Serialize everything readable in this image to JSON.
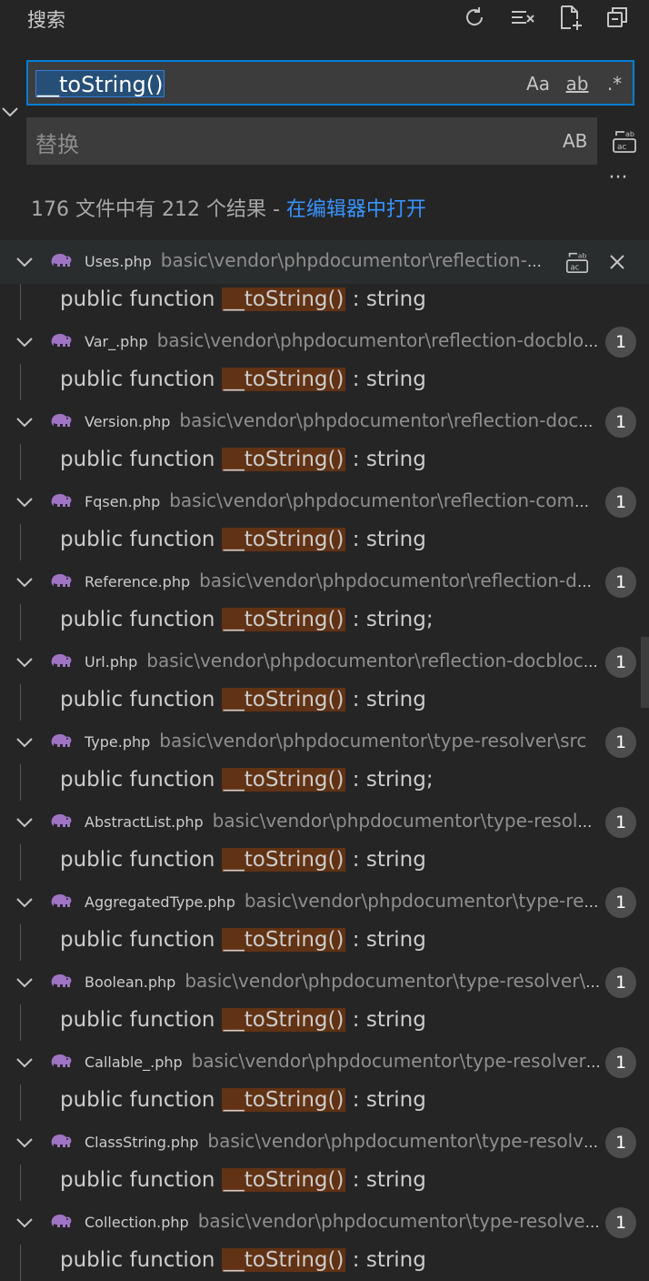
{
  "panel": {
    "title": "搜索",
    "actions": [
      {
        "name": "refresh-icon"
      },
      {
        "name": "clear-results-icon"
      },
      {
        "name": "new-search-editor-icon"
      },
      {
        "name": "collapse-all-icon"
      }
    ]
  },
  "search": {
    "value": "__toString()",
    "options": {
      "match_case": "Aa",
      "whole_word": "ab",
      "regex": ".*"
    }
  },
  "replace": {
    "placeholder": "替换",
    "preserve_case": "AB"
  },
  "summary": {
    "text": "176 文件中有 212 个结果 - ",
    "link": "在编辑器中打开"
  },
  "results": [
    {
      "file": "Uses.php",
      "path": "basic\\vendor\\phpdocumentor\\reflection-docblock\\src\\DocBlock\\Tags\\Uses.php",
      "count": "",
      "match_prefix": "public function ",
      "match": "__toString()",
      "match_suffix": " : string",
      "selected": true
    },
    {
      "file": "Var_.php",
      "path": "basic\\vendor\\phpdocumentor\\reflection-docblock\\src\\DocBlock\\Tags",
      "count": "1",
      "match_prefix": "public function ",
      "match": "__toString()",
      "match_suffix": " : string"
    },
    {
      "file": "Version.php",
      "path": "basic\\vendor\\phpdocumentor\\reflection-docblock\\src\\DocBlock",
      "count": "1",
      "match_prefix": "public function ",
      "match": "__toString()",
      "match_suffix": " : string"
    },
    {
      "file": "Fqsen.php",
      "path": "basic\\vendor\\phpdocumentor\\reflection-common\\src",
      "count": "1",
      "match_prefix": "public function ",
      "match": "__toString()",
      "match_suffix": " : string"
    },
    {
      "file": "Reference.php",
      "path": "basic\\vendor\\phpdocumentor\\reflection-docblock\\src",
      "count": "1",
      "match_prefix": "public function ",
      "match": "__toString()",
      "match_suffix": " : string;"
    },
    {
      "file": "Url.php",
      "path": "basic\\vendor\\phpdocumentor\\reflection-docblock\\src\\DocBlock",
      "count": "1",
      "match_prefix": "public function ",
      "match": "__toString()",
      "match_suffix": " : string"
    },
    {
      "file": "Type.php",
      "path": "basic\\vendor\\phpdocumentor\\type-resolver\\src",
      "count": "1",
      "match_prefix": "public function ",
      "match": "__toString()",
      "match_suffix": " : string;"
    },
    {
      "file": "AbstractList.php",
      "path": "basic\\vendor\\phpdocumentor\\type-resolver\\src\\Types",
      "count": "1",
      "match_prefix": "public function ",
      "match": "__toString()",
      "match_suffix": " : string"
    },
    {
      "file": "AggregatedType.php",
      "path": "basic\\vendor\\phpdocumentor\\type-resolver\\src\\Types",
      "count": "1",
      "match_prefix": "public function ",
      "match": "__toString()",
      "match_suffix": " : string"
    },
    {
      "file": "Boolean.php",
      "path": "basic\\vendor\\phpdocumentor\\type-resolver\\src\\Types",
      "count": "1",
      "match_prefix": "public function ",
      "match": "__toString()",
      "match_suffix": " : string"
    },
    {
      "file": "Callable_.php",
      "path": "basic\\vendor\\phpdocumentor\\type-resolver\\src\\Types",
      "count": "1",
      "match_prefix": "public function ",
      "match": "__toString()",
      "match_suffix": " : string"
    },
    {
      "file": "ClassString.php",
      "path": "basic\\vendor\\phpdocumentor\\type-resolver\\src\\Types",
      "count": "1",
      "match_prefix": "public function ",
      "match": "__toString()",
      "match_suffix": " : string"
    },
    {
      "file": "Collection.php",
      "path": "basic\\vendor\\phpdocumentor\\type-resolver\\src\\Types",
      "count": "1",
      "match_prefix": "public function ",
      "match": "__toString()",
      "match_suffix": " : string"
    }
  ],
  "colors": {
    "background": "#252526",
    "input_bg": "#3c3c3c",
    "focus_border": "#007fd4",
    "match_highlight": "#613214",
    "link": "#3794ff",
    "php_icon": "#a074c4",
    "badge_bg": "#4d4d4d"
  }
}
